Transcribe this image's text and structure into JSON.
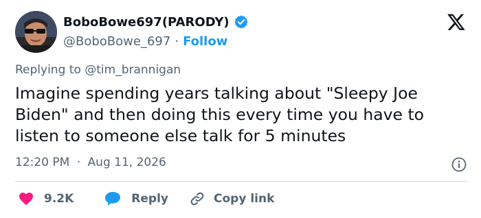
{
  "author": {
    "display_name": "BoboBowe697(PARODY)",
    "handle": "@BoboBowe_697",
    "separator": "·",
    "follow_label": "Follow",
    "verified_color": "#1d9bf0"
  },
  "replying": {
    "prefix": "Replying to",
    "target": "@tim_brannigan"
  },
  "tweet": {
    "text": "Imagine spending years talking about \"Sleepy Joe Biden\" and then doing this every time you have to listen to someone else talk for 5 minutes"
  },
  "meta": {
    "time": "12:20 PM",
    "separator": "·",
    "date": "Aug 11, 2026"
  },
  "actions": {
    "likes_count": "9.2K",
    "reply_label": "Reply",
    "copy_label": "Copy link"
  },
  "icons": {
    "logo": "x-logo-icon",
    "verified": "verified-badge-icon",
    "info": "info-icon",
    "like": "heart-icon",
    "reply": "speech-bubble-icon",
    "copy": "link-icon"
  },
  "colors": {
    "like": "#f91880",
    "reply": "#1d9bf0",
    "link": "#1d9bf0",
    "secondary_text": "#536471"
  }
}
